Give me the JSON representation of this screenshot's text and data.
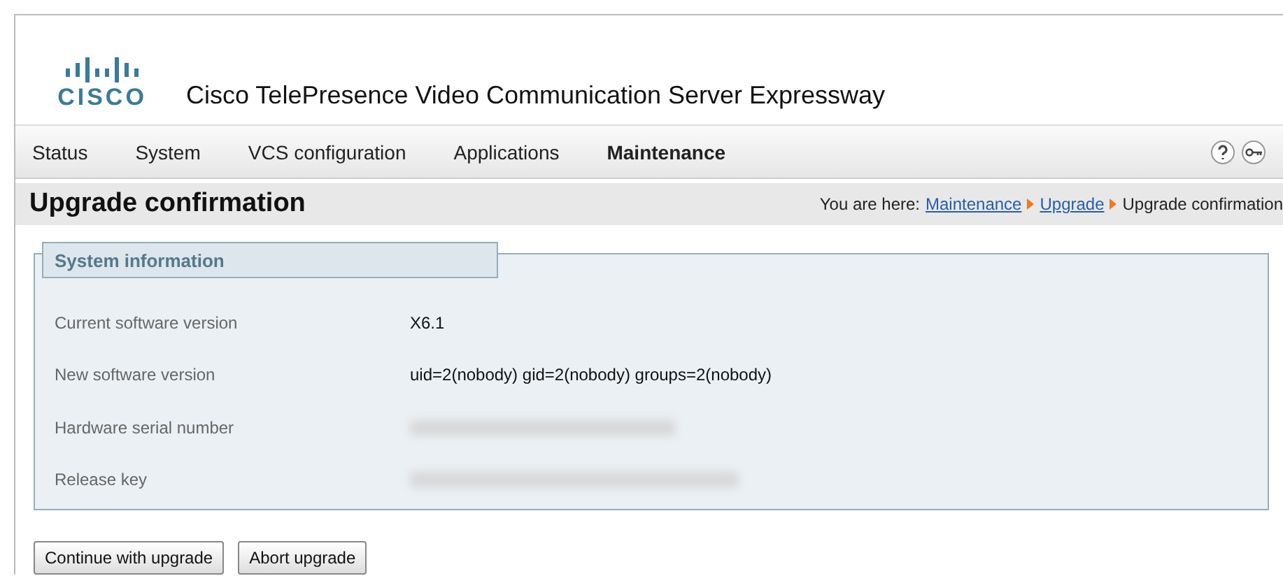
{
  "header": {
    "logo_text": "CISCO",
    "title": "Cisco TelePresence  Video Communication Server Expressway"
  },
  "nav": {
    "items": [
      {
        "label": "Status",
        "selected": false
      },
      {
        "label": "System",
        "selected": false
      },
      {
        "label": "VCS configuration",
        "selected": false
      },
      {
        "label": "Applications",
        "selected": false
      },
      {
        "label": "Maintenance",
        "selected": true
      }
    ]
  },
  "page_title": "Upgrade confirmation",
  "breadcrumb": {
    "prefix": "You are here:",
    "links": [
      "Maintenance",
      "Upgrade"
    ],
    "current": "Upgrade confirmation"
  },
  "section": {
    "title": "System information",
    "rows": [
      {
        "label": "Current software version",
        "kind": "text",
        "value": "X6.1"
      },
      {
        "label": "New software version",
        "kind": "text",
        "value": "uid=2(nobody) gid=2(nobody) groups=2(nobody)"
      },
      {
        "label": "Hardware serial number",
        "kind": "redacted"
      },
      {
        "label": "Release key",
        "kind": "redacted"
      }
    ]
  },
  "buttons": [
    "Continue with upgrade",
    "Abort upgrade"
  ]
}
